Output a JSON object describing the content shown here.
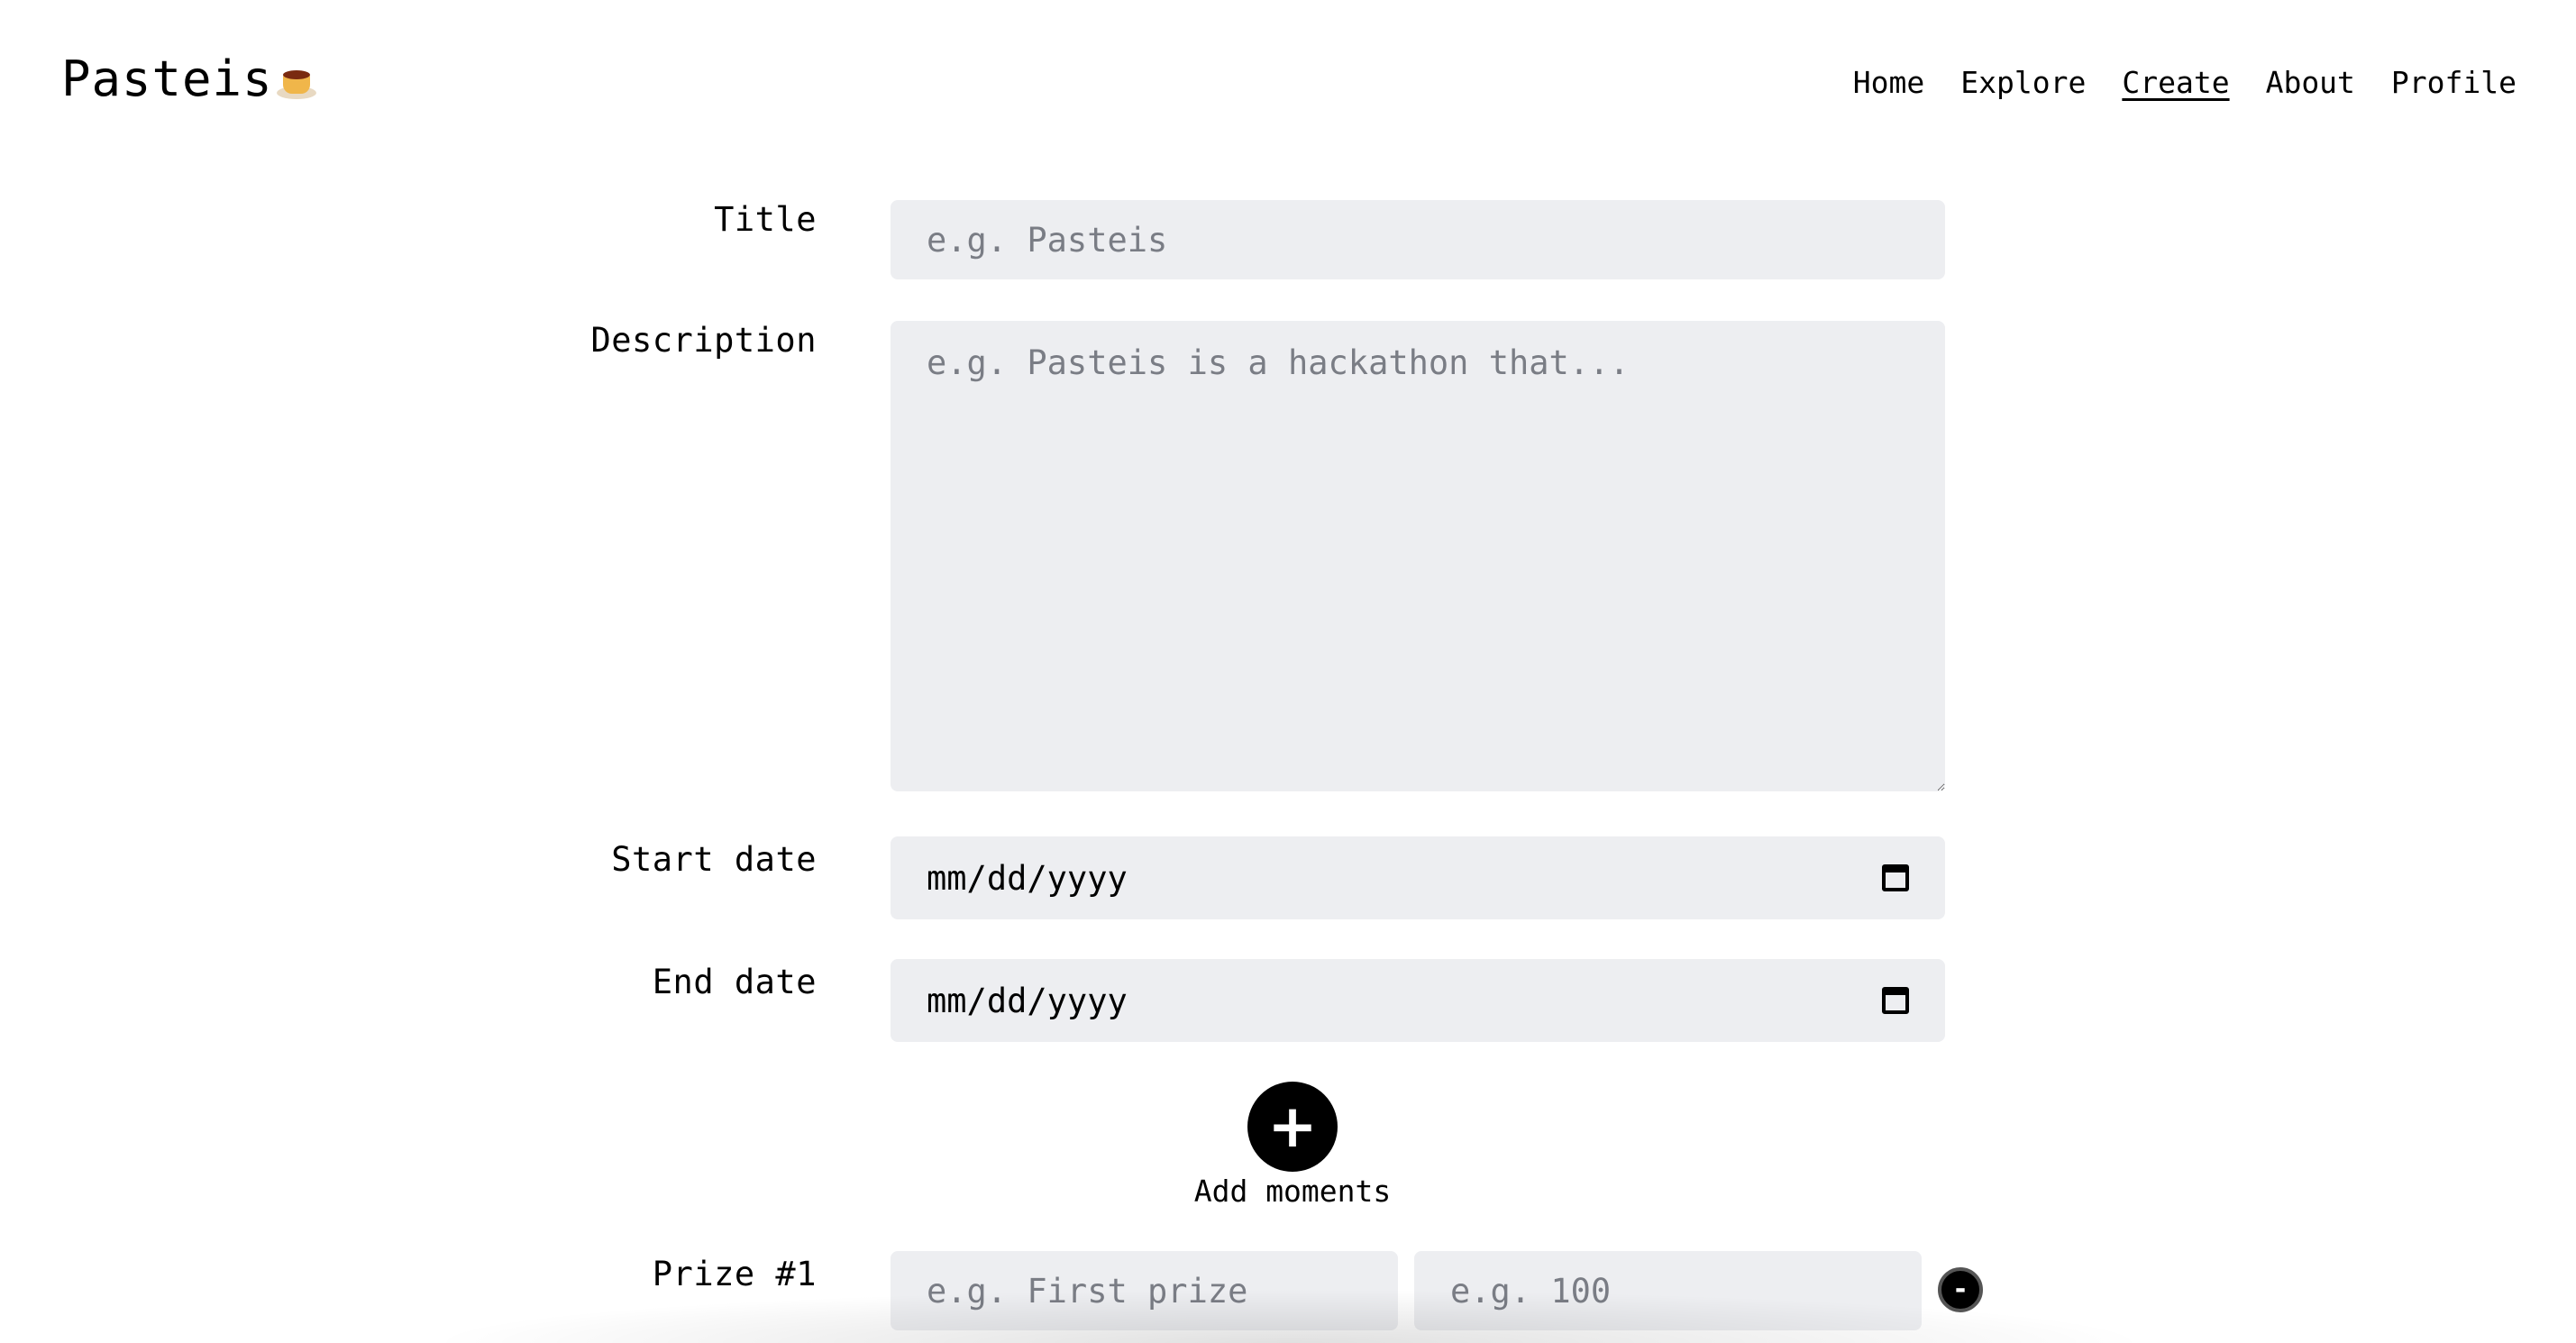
{
  "header": {
    "logo_text": "Pasteis",
    "logo_icon": "flan-icon",
    "nav": [
      {
        "label": "Home"
      },
      {
        "label": "Explore"
      },
      {
        "label": "Create",
        "active": true
      },
      {
        "label": "About"
      },
      {
        "label": "Profile"
      }
    ]
  },
  "form": {
    "title": {
      "label": "Title",
      "placeholder": "e.g. Pasteis",
      "value": ""
    },
    "description": {
      "label": "Description",
      "placeholder": "e.g. Pasteis is a hackathon that...",
      "value": ""
    },
    "start_date": {
      "label": "Start date",
      "value": "mm/dd/yyyy",
      "icon": "calendar-icon"
    },
    "end_date": {
      "label": "End date",
      "value": "mm/dd/yyyy",
      "icon": "calendar-icon"
    },
    "add_moments": {
      "icon": "+",
      "label": "Add moments"
    },
    "prizes": [
      {
        "label": "Prize #1",
        "name_placeholder": "e.g. First prize",
        "amount_placeholder": "e.g. 100",
        "remove_icon": "-"
      }
    ]
  }
}
